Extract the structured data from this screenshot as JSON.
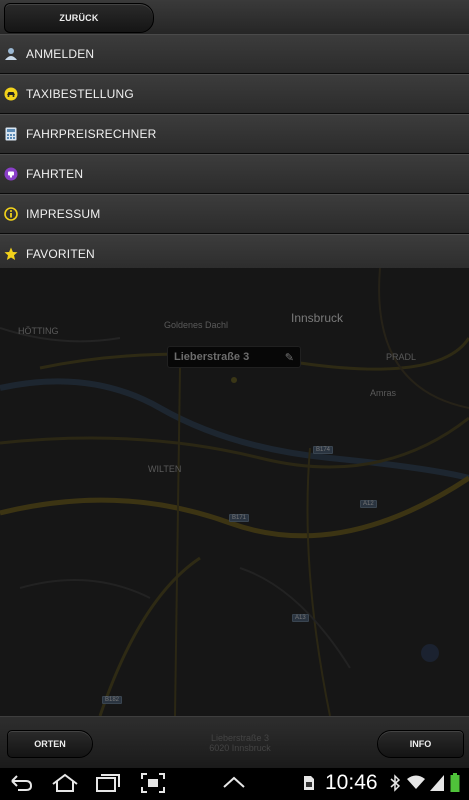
{
  "header": {
    "back_label": "ZURÜCK"
  },
  "menu": {
    "items": [
      {
        "label": "ANMELDEN",
        "icon": "user-icon"
      },
      {
        "label": "TAXIBESTELLUNG",
        "icon": "taxi-icon"
      },
      {
        "label": "FAHRPREISRECHNER",
        "icon": "calculator-icon"
      },
      {
        "label": "FAHRTEN",
        "icon": "trips-icon"
      },
      {
        "label": "IMPRESSUM",
        "icon": "info-icon"
      },
      {
        "label": "FAVORITEN",
        "icon": "star-icon"
      }
    ]
  },
  "map": {
    "pin_address": "Lieberstraße 3",
    "labels": [
      "Innsbruck",
      "HÖTTING",
      "Goldenes Dachl",
      "WILTEN",
      "PRADL",
      "Amras"
    ],
    "road_shields": [
      "B174",
      "B171",
      "A12",
      "A13",
      "B182"
    ]
  },
  "footer": {
    "orten_label": "ORTEN",
    "info_label": "INFO",
    "address_line1": "Lieberstraße 3",
    "address_line2": "6020 Innsbruck"
  },
  "status_bar": {
    "time": "10:46"
  },
  "colors": {
    "accent_yellow": "#f2d21b",
    "fahrten_purple": "#8a3fc9",
    "background": "#0c0c0c"
  }
}
